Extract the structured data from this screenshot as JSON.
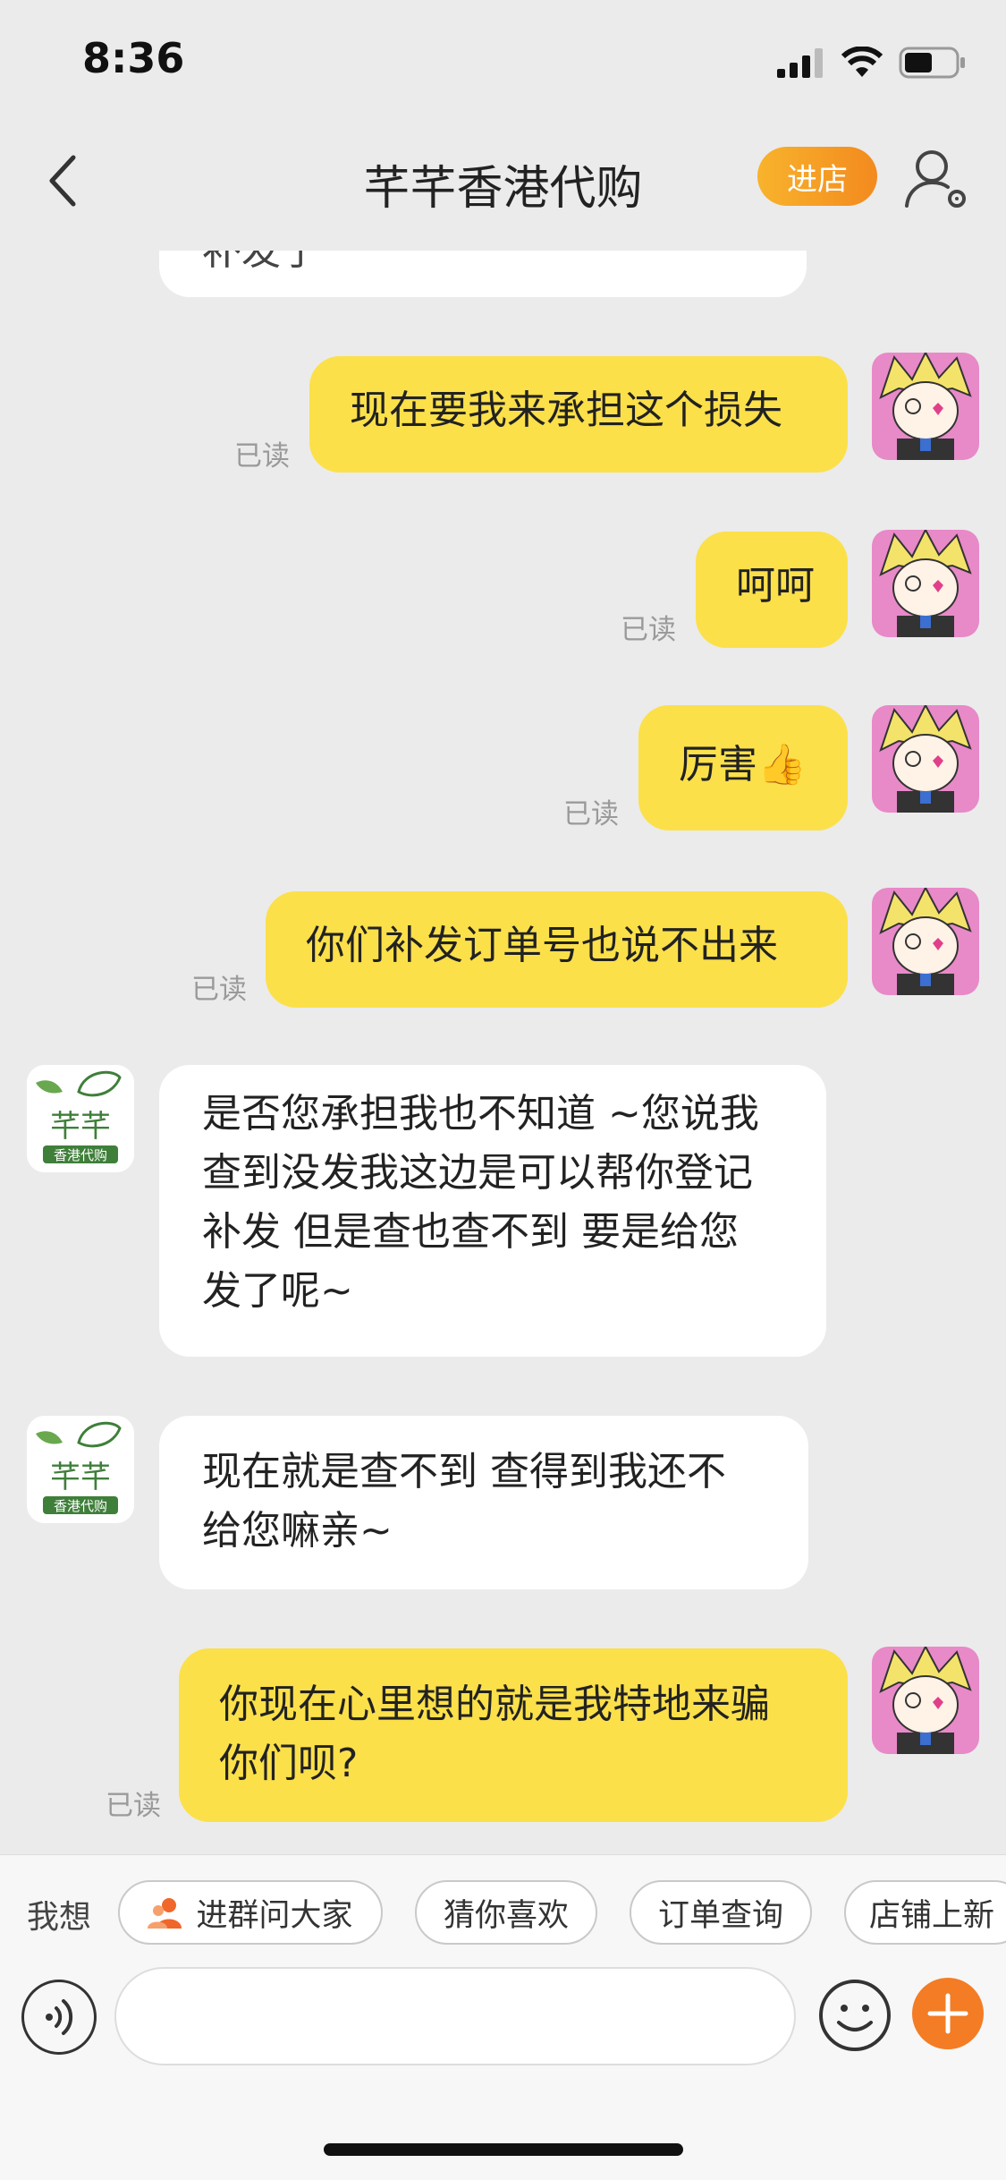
{
  "status_bar": {
    "time": "8:36"
  },
  "nav": {
    "title": "芊芊香港代购",
    "enter_shop": "进店"
  },
  "shop_avatar": {
    "name_line": "芊芊",
    "sub_line": "香港代购"
  },
  "messages": {
    "m0": {
      "text": "补发了"
    },
    "m1": {
      "text": "现在要我来承担这个损失",
      "read": "已读"
    },
    "m2": {
      "text": "呵呵",
      "read": "已读"
    },
    "m3": {
      "text": "厉害👍",
      "read": "已读"
    },
    "m4": {
      "text": "你们补发订单号也说不出来",
      "read": "已读"
    },
    "m5": {
      "lines": [
        "是否您承担我也不知道 ~您说我",
        "查到没发我这边是可以帮你登记",
        "补发 但是查也查不到  要是给您",
        "发了呢~"
      ]
    },
    "m6": {
      "lines": [
        "现在就是查不到  查得到我还不",
        "给您嘛亲~"
      ]
    },
    "m7": {
      "lines": [
        "你现在心里想的就是我特地来骗",
        "你们呗?"
      ],
      "read": "已读"
    }
  },
  "suggestions": {
    "label": "我想",
    "chips": [
      "进群问大家",
      "猜你喜欢",
      "订单查询",
      "店铺上新"
    ]
  },
  "colors": {
    "my_bubble": "#fbe04a",
    "accent": "#f47c24"
  }
}
